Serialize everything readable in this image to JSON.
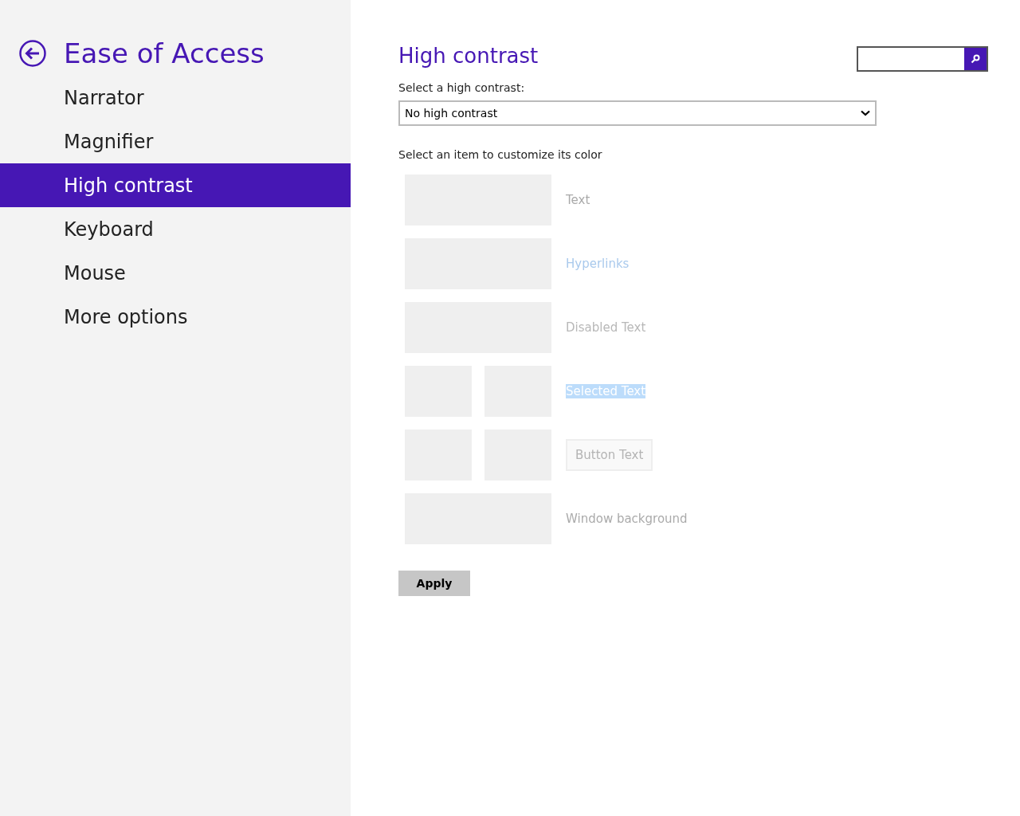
{
  "sidebar": {
    "title": "Ease of Access",
    "items": [
      {
        "label": "Narrator",
        "selected": false
      },
      {
        "label": "Magnifier",
        "selected": false
      },
      {
        "label": "High contrast",
        "selected": true
      },
      {
        "label": "Keyboard",
        "selected": false
      },
      {
        "label": "Mouse",
        "selected": false
      },
      {
        "label": "More options",
        "selected": false
      }
    ]
  },
  "main": {
    "title": "High contrast",
    "select_label": "Select a high contrast:",
    "select_value": "No high contrast",
    "customize_label": "Select an item to customize its color",
    "color_items": [
      {
        "kind": "text",
        "label": "Text"
      },
      {
        "kind": "hyperlink",
        "label": "Hyperlinks"
      },
      {
        "kind": "disabled",
        "label": "Disabled Text"
      },
      {
        "kind": "selected",
        "label": "Selected Text"
      },
      {
        "kind": "button",
        "label": "Button Text"
      },
      {
        "kind": "background",
        "label": "Window background"
      }
    ],
    "apply": "Apply"
  }
}
